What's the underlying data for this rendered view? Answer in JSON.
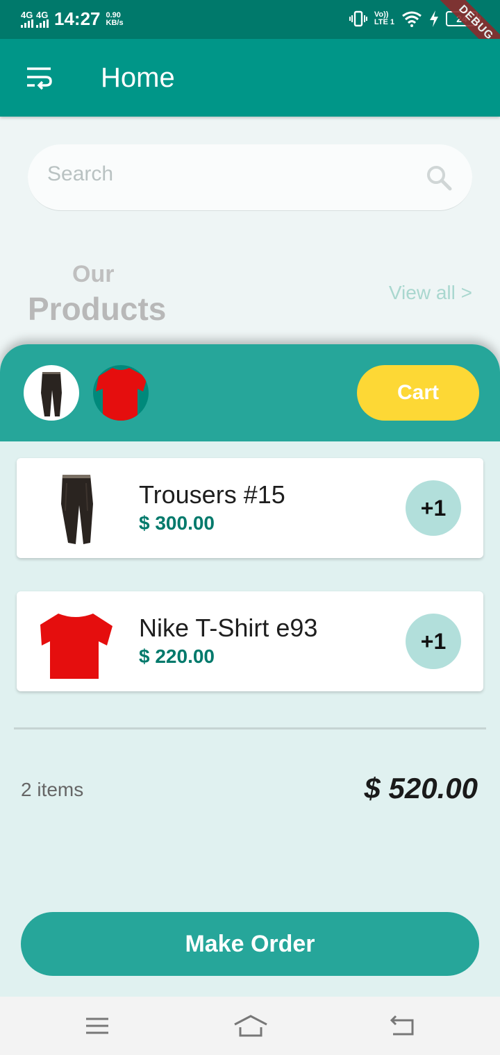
{
  "status_bar": {
    "network1": "4G",
    "network2": "4G",
    "time": "14:27",
    "speed_value": "0.90",
    "speed_unit": "KB/s",
    "volte_top": "Vo))",
    "volte_bottom": "LTE 1",
    "battery": "24",
    "debug": "DEBUG"
  },
  "app_bar": {
    "title": "Home",
    "menu_icon": "sort-menu-icon"
  },
  "search": {
    "placeholder": "Search",
    "icon": "search-icon"
  },
  "section": {
    "small": "Our",
    "big": "Products",
    "view_all": "View all >"
  },
  "cart": {
    "button_label": "Cart",
    "thumbnails": [
      "trousers-thumbnail",
      "tshirt-thumbnail"
    ],
    "items": [
      {
        "name": "Trousers #15",
        "price": "$ 300.00",
        "add_label": "+1"
      },
      {
        "name": "Nike T-Shirt e93",
        "price": "$ 220.00",
        "add_label": "+1"
      }
    ],
    "count": "2 items",
    "total": "$ 520.00",
    "order_label": "Make Order"
  },
  "colors": {
    "primary": "#009688",
    "status": "#00796b",
    "cart_header": "#26a69a",
    "accent_yellow": "#fdd835",
    "plus_bg": "#b2dfdb",
    "panel_bg": "#e0f1f0"
  }
}
